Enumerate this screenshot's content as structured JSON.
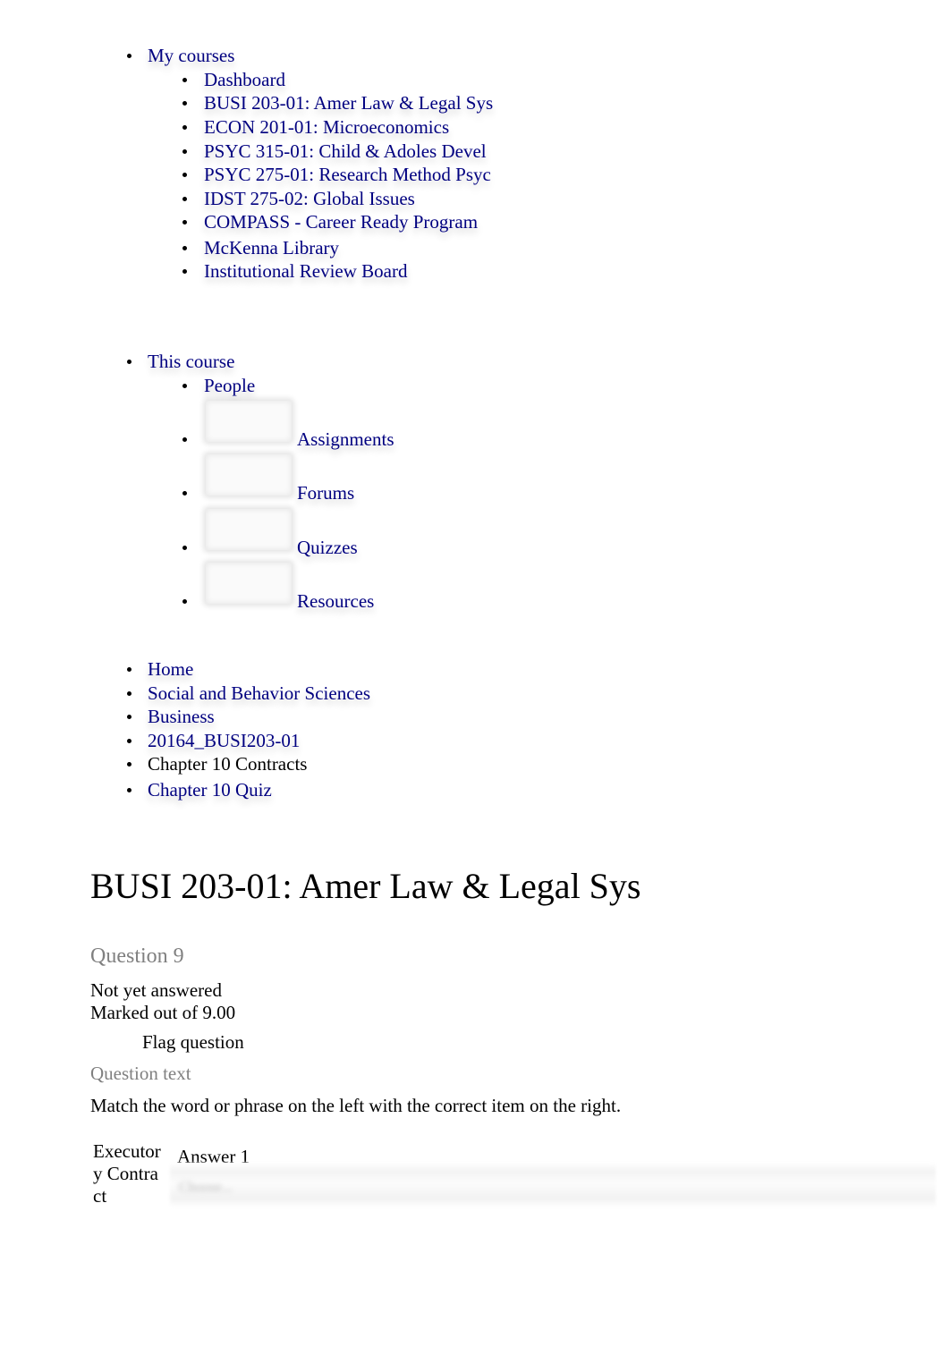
{
  "nav": {
    "my_courses": {
      "label": "My courses",
      "items": [
        {
          "label": "Dashboard"
        },
        {
          "label": "BUSI 203-01: Amer Law & Legal Sys"
        },
        {
          "label": "ECON 201-01: Microeconomics"
        },
        {
          "label": "PSYC 315-01: Child & Adoles Devel"
        },
        {
          "label": "PSYC 275-01: Research Method Psyc"
        },
        {
          "label": "IDST 275-02: Global Issues"
        },
        {
          "label": "COMPASS - Career Ready Program"
        },
        {
          "label": "McKenna Library"
        },
        {
          "label": "Institutional Review Board"
        }
      ]
    },
    "this_course": {
      "label": "This course",
      "items": [
        {
          "label": "People",
          "icon": "none"
        },
        {
          "label": "Assignments",
          "icon": "assignments-icon"
        },
        {
          "label": "Forums",
          "icon": "forums-icon"
        },
        {
          "label": "Quizzes",
          "icon": "quizzes-icon"
        },
        {
          "label": "Resources",
          "icon": "resources-icon"
        }
      ]
    }
  },
  "breadcrumb": [
    {
      "label": "Home",
      "link": true
    },
    {
      "label": "Social and Behavior Sciences",
      "link": true
    },
    {
      "label": "Business",
      "link": true
    },
    {
      "label": "20164_BUSI203-01",
      "link": true
    },
    {
      "label": "Chapter 10 Contracts",
      "link": false
    },
    {
      "label": "Chapter 10 Quiz",
      "link": true
    }
  ],
  "page": {
    "title": "BUSI 203-01: Amer Law & Legal Sys"
  },
  "question": {
    "number_label": "Question 9",
    "state": "Not yet answered",
    "grade": "Marked out of 9.00",
    "flag_label": "Flag question",
    "text_label": "Question text",
    "prompt": "Match the word or phrase on the left with the correct item on the right.",
    "matches": [
      {
        "term": "Executory Contract",
        "answer_label": "Answer 1",
        "selected": "Choose..."
      }
    ]
  },
  "colors": {
    "link": "#000080",
    "muted": "#808080",
    "text": "#000000"
  }
}
